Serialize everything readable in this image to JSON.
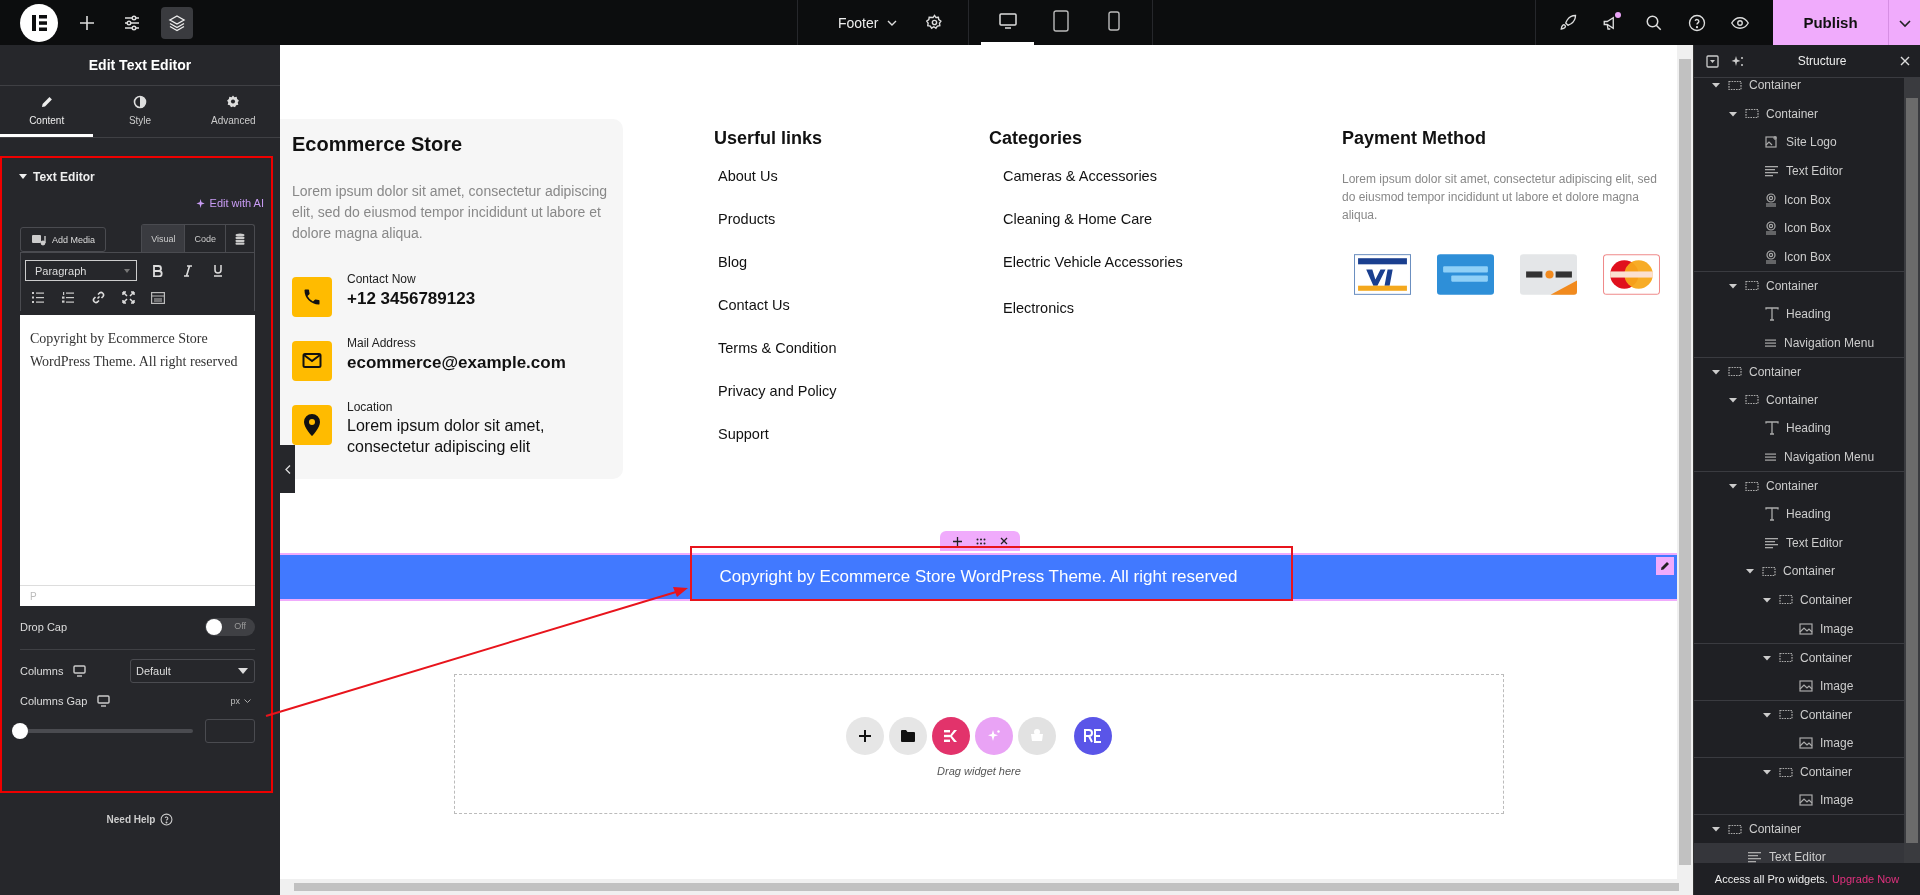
{
  "topbar": {
    "document": "Footer",
    "publish": "Publish",
    "devices": [
      {
        "kind": "desktop",
        "selected": true
      },
      {
        "kind": "tablet",
        "selected": false
      },
      {
        "kind": "mobile",
        "selected": false
      }
    ]
  },
  "panel": {
    "title": "Edit Text Editor",
    "tabs": [
      {
        "label": "Content",
        "kind": "pencil",
        "selected": true
      },
      {
        "label": "Style",
        "kind": "contrast",
        "selected": false
      },
      {
        "label": "Advanced",
        "kind": "gear",
        "selected": false
      }
    ],
    "section": "Text Editor",
    "edit_ai": "Edit with AI",
    "add_media": "Add Media",
    "editor_tabs": [
      {
        "label": "Visual",
        "selected": true
      },
      {
        "label": "Code",
        "selected": false
      }
    ],
    "format": "Paragraph",
    "content": "Copyright by Ecommerce Store WordPress Theme. All right reserved",
    "path": "P",
    "drop_cap": {
      "label": "Drop Cap",
      "on": false,
      "state": "Off"
    },
    "columns": {
      "label": "Columns",
      "value": "Default"
    },
    "columns_gap": {
      "label": "Columns Gap",
      "unit": "px",
      "level": 0
    },
    "help": "Need Help"
  },
  "footer": {
    "brand": {
      "title": "Ecommerce Store",
      "text": "Lorem ipsum dolor sit amet, consectetur adipiscing elit, sed do eiusmod tempor incididunt ut labore et dolore magna aliqua.",
      "contacts": [
        {
          "kind": "phone",
          "label": "Contact Now",
          "value": "+12 3456789123"
        },
        {
          "kind": "mail",
          "label": "Mail Address",
          "value": "ecommerce@example.com"
        },
        {
          "kind": "location",
          "label": "Location",
          "value": "Lorem ipsum dolor sit amet, consectetur adipiscing elit"
        }
      ]
    },
    "links": {
      "title": "Userful links",
      "items": [
        "About Us",
        "Products",
        "Blog",
        "Contact Us",
        "Terms & Condition",
        "Privacy and Policy",
        "Support"
      ]
    },
    "categories": {
      "title": "Categories",
      "items": [
        "Cameras & Accessories",
        "Cleaning & Home Care",
        "Electric Vehicle Accessories",
        "Electronics"
      ]
    },
    "payment": {
      "title": "Payment Method",
      "text": "Lorem ipsum dolor sit amet, consectetur adipiscing elit, sed do eiusmod tempor incididunt ut labore et dolore magna aliqua.",
      "cards": [
        {
          "kind": "visa"
        },
        {
          "kind": "amex"
        },
        {
          "kind": "discover"
        },
        {
          "kind": "mastercard"
        }
      ]
    }
  },
  "copyright": "Copyright by Ecommerce Store WordPress Theme. All right reserved",
  "drop_zone": {
    "hint": "Drag widget here",
    "buttons": [
      {
        "kind": "add"
      },
      {
        "kind": "folder"
      },
      {
        "kind": "ek"
      },
      {
        "kind": "ai"
      },
      {
        "kind": "kit"
      },
      {
        "kind": "re"
      }
    ]
  },
  "structure": {
    "title": "Structure",
    "promo": "Access all Pro widgets.",
    "upgrade": "Upgrade Now",
    "tree": [
      {
        "label": "Container",
        "kind": "container",
        "expanded": true,
        "selected": false,
        "children": [
          {
            "label": "Container",
            "kind": "container",
            "expanded": true,
            "selected": false,
            "children": [
              {
                "label": "Site Logo",
                "kind": "logo",
                "selected": false
              },
              {
                "label": "Text Editor",
                "kind": "text",
                "selected": false
              },
              {
                "label": "Icon Box",
                "kind": "iconbox",
                "selected": false
              },
              {
                "label": "Icon Box",
                "kind": "iconbox",
                "selected": false
              },
              {
                "label": "Icon Box",
                "kind": "iconbox",
                "selected": false
              }
            ]
          },
          {
            "label": "Container",
            "kind": "container",
            "expanded": true,
            "selected": false,
            "children": [
              {
                "label": "Heading",
                "kind": "heading",
                "selected": false
              },
              {
                "label": "Navigation Menu",
                "kind": "nav",
                "selected": false
              }
            ]
          }
        ]
      },
      {
        "label": "Container",
        "kind": "container",
        "expanded": true,
        "selected": false,
        "children": [
          {
            "label": "Container",
            "kind": "container",
            "expanded": true,
            "selected": false,
            "children": [
              {
                "label": "Heading",
                "kind": "heading",
                "selected": false
              },
              {
                "label": "Navigation Menu",
                "kind": "nav",
                "selected": false
              }
            ]
          },
          {
            "label": "Container",
            "kind": "container",
            "expanded": true,
            "selected": false,
            "children": [
              {
                "label": "Heading",
                "kind": "heading",
                "selected": false
              },
              {
                "label": "Text Editor",
                "kind": "text",
                "selected": false
              },
              {
                "label": "Container",
                "kind": "container",
                "expanded": true,
                "selected": false,
                "children": [
                  {
                    "label": "Container",
                    "kind": "container",
                    "expanded": true,
                    "selected": false,
                    "children": [
                      {
                        "label": "Image",
                        "kind": "image",
                        "selected": false
                      }
                    ]
                  },
                  {
                    "label": "Container",
                    "kind": "container",
                    "expanded": true,
                    "selected": false,
                    "children": [
                      {
                        "label": "Image",
                        "kind": "image",
                        "selected": false
                      }
                    ]
                  },
                  {
                    "label": "Container",
                    "kind": "container",
                    "expanded": true,
                    "selected": false,
                    "children": [
                      {
                        "label": "Image",
                        "kind": "image",
                        "selected": false
                      }
                    ]
                  },
                  {
                    "label": "Container",
                    "kind": "container",
                    "expanded": true,
                    "selected": false,
                    "children": [
                      {
                        "label": "Image",
                        "kind": "image",
                        "selected": false
                      }
                    ]
                  }
                ]
              }
            ]
          }
        ]
      },
      {
        "label": "Container",
        "kind": "container",
        "expanded": true,
        "selected": false,
        "children": [
          {
            "label": "Text Editor",
            "kind": "text",
            "selected": true
          }
        ]
      }
    ]
  }
}
